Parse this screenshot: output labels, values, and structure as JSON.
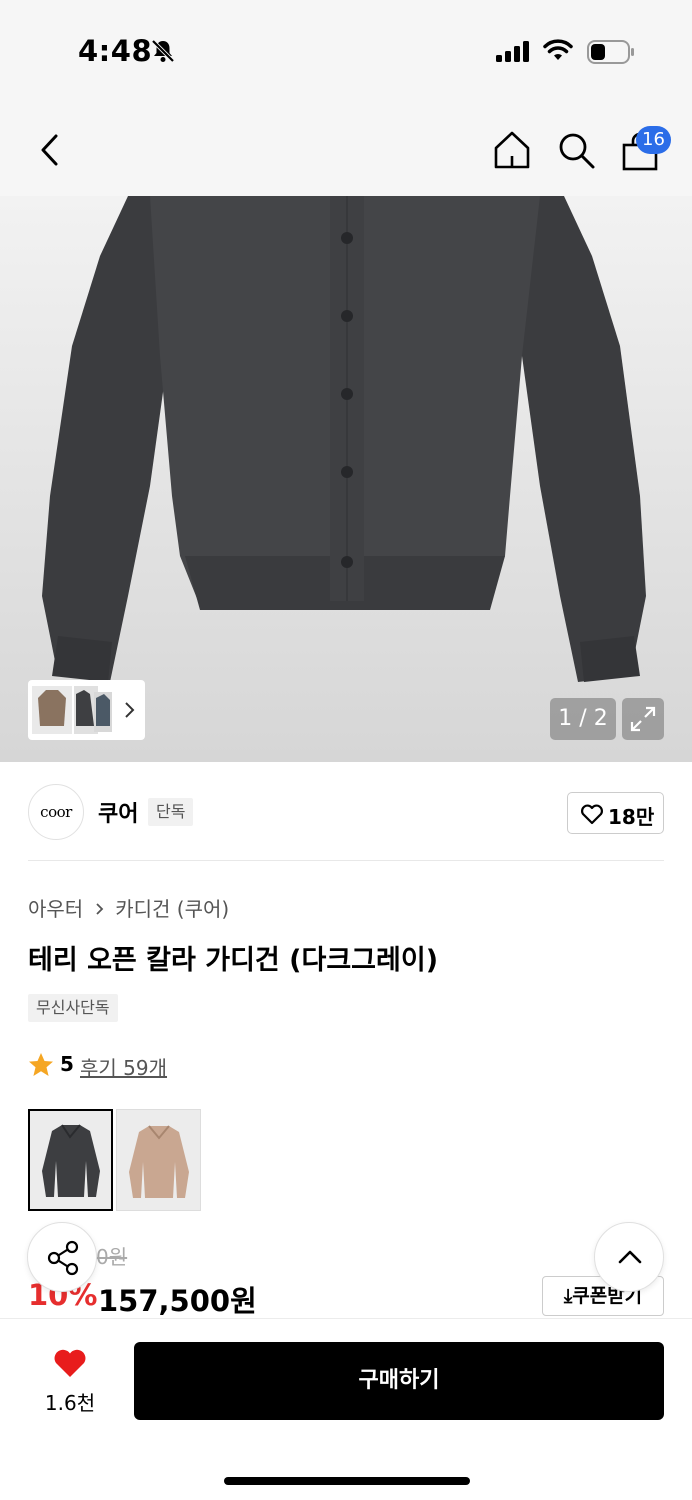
{
  "status_bar": {
    "time": "4:48",
    "icons": [
      "bell-slash-icon",
      "cellular-signal-icon",
      "wifi-icon",
      "battery-icon"
    ]
  },
  "nav": {
    "icons": [
      "back-chevron-icon",
      "home-icon",
      "search-icon",
      "shopping-bag-icon"
    ],
    "cart_badge": "16",
    "badge_color": "#2b6de8"
  },
  "gallery": {
    "page_counter": "1 / 2",
    "icons": [
      "thumbnail-chevron-icon",
      "expand-icon"
    ]
  },
  "brand": {
    "logo_text": "coor",
    "name": "쿠어",
    "tag": "단독",
    "like_count": "18만"
  },
  "product": {
    "breadcrumb": [
      "아우터",
      "카디건 (쿠어)"
    ],
    "title": "테리 오픈 칼라 가디건 (다크그레이)",
    "exclusive_badge": "무신사단독",
    "rating": "5",
    "review_link": "후기 59개",
    "star_color": "#f5a623"
  },
  "pricing": {
    "original_price_visible": "0원",
    "discount": "10%",
    "sale_price": "157,500원",
    "coupon_label": "쿠폰받기",
    "discount_color": "#e62e2e"
  },
  "bottom_bar": {
    "like_count": "1.6천",
    "buy_label": "구매하기",
    "heart_color": "#e81c1c"
  }
}
